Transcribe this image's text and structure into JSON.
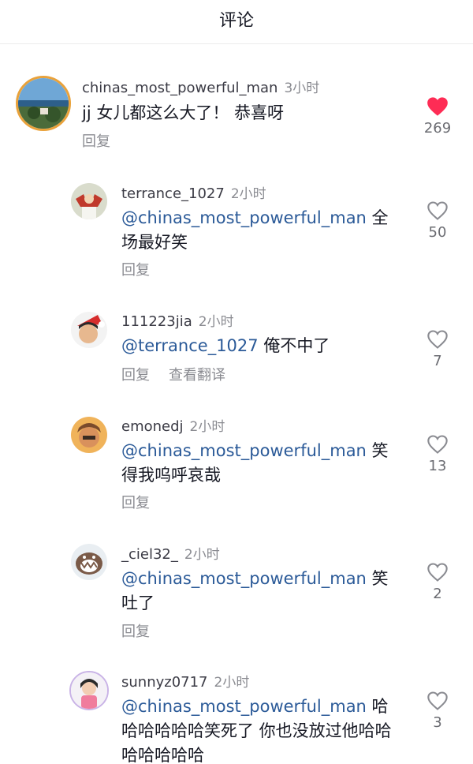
{
  "header": {
    "title": "评论"
  },
  "comments": [
    {
      "username": "chinas_most_powerful_man",
      "time": "3小时",
      "mention": "",
      "text": "jj 女儿都这么大了！ 恭喜呀",
      "actions": [
        "回复"
      ],
      "likes": "269",
      "liked": true
    },
    {
      "username": "terrance_1027",
      "time": "2小时",
      "mention": "@chinas_most_powerful_man",
      "text": " 全场最好笑",
      "actions": [
        "回复"
      ],
      "likes": "50",
      "liked": false
    },
    {
      "username": "111223jia",
      "time": "2小时",
      "mention": "@terrance_1027",
      "text": " 俺不中了",
      "actions": [
        "回复",
        "查看翻译"
      ],
      "likes": "7",
      "liked": false
    },
    {
      "username": "emonedj",
      "time": "2小时",
      "mention": "@chinas_most_powerful_man",
      "text": " 笑得我呜呼哀哉",
      "actions": [
        "回复"
      ],
      "likes": "13",
      "liked": false
    },
    {
      "username": "_ciel32_",
      "time": "2小时",
      "mention": "@chinas_most_powerful_man",
      "text": " 笑吐了",
      "actions": [
        "回复"
      ],
      "likes": "2",
      "liked": false
    },
    {
      "username": "sunnyz0717",
      "time": "2小时",
      "mention": "@chinas_most_powerful_man",
      "text": " 哈哈哈哈哈哈笑死了 你也没放过他哈哈哈哈哈哈哈",
      "actions": [],
      "likes": "3",
      "liked": false
    }
  ],
  "colors": {
    "like_red": "#fe2c55",
    "mention_blue": "#2b5a98"
  },
  "icons": {
    "liked": "heart-filled-icon",
    "unliked": "heart-outline-icon"
  }
}
